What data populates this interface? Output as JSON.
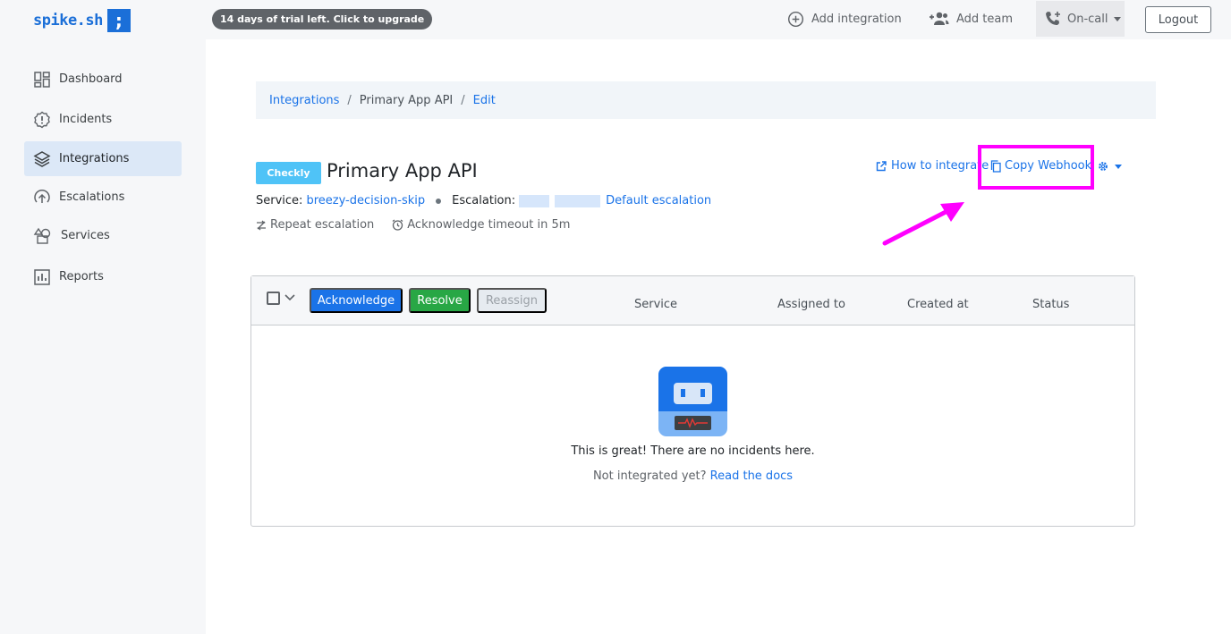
{
  "brand": {
    "name": "spike.sh",
    "mark": ";"
  },
  "topbar": {
    "trial_text": "14 days of trial left. Click to upgrade",
    "add_integration": "Add integration",
    "add_team": "Add team",
    "oncall": "On-call",
    "logout": "Logout"
  },
  "sidebar": {
    "items": [
      {
        "label": "Dashboard",
        "icon": "dashboard-icon"
      },
      {
        "label": "Incidents",
        "icon": "incidents-icon"
      },
      {
        "label": "Integrations",
        "icon": "layers-icon",
        "active": true
      },
      {
        "label": "Escalations",
        "icon": "escalation-icon"
      },
      {
        "label": "Services",
        "icon": "services-icon"
      },
      {
        "label": "Reports",
        "icon": "reports-icon"
      }
    ]
  },
  "breadcrumb": {
    "root": "Integrations",
    "item": "Primary App API",
    "action": "Edit"
  },
  "integration": {
    "tag": "Checkly",
    "title": "Primary App API",
    "service_label": "Service:",
    "service_value": "breezy-decision-skip",
    "escalation_label": "Escalation:",
    "escalation_value": "Default escalation",
    "repeat_escalation": "Repeat escalation",
    "ack_timeout": "Acknowledge timeout in 5m"
  },
  "actions": {
    "how_to_integrate": "How to integrate",
    "copy_webhook": "Copy Webhook"
  },
  "table": {
    "buttons": {
      "acknowledge": "Acknowledge",
      "resolve": "Resolve",
      "reassign": "Reassign"
    },
    "columns": [
      "Service",
      "Assigned to",
      "Created at",
      "Status"
    ],
    "empty_title": "This is great! There are no incidents here.",
    "empty_sub": "Not integrated yet?",
    "empty_link": "Read the docs"
  },
  "colors": {
    "accent": "#1a73e8",
    "highlight": "#ff00ff",
    "success": "#28a745",
    "badge": "#4fc3f7"
  }
}
